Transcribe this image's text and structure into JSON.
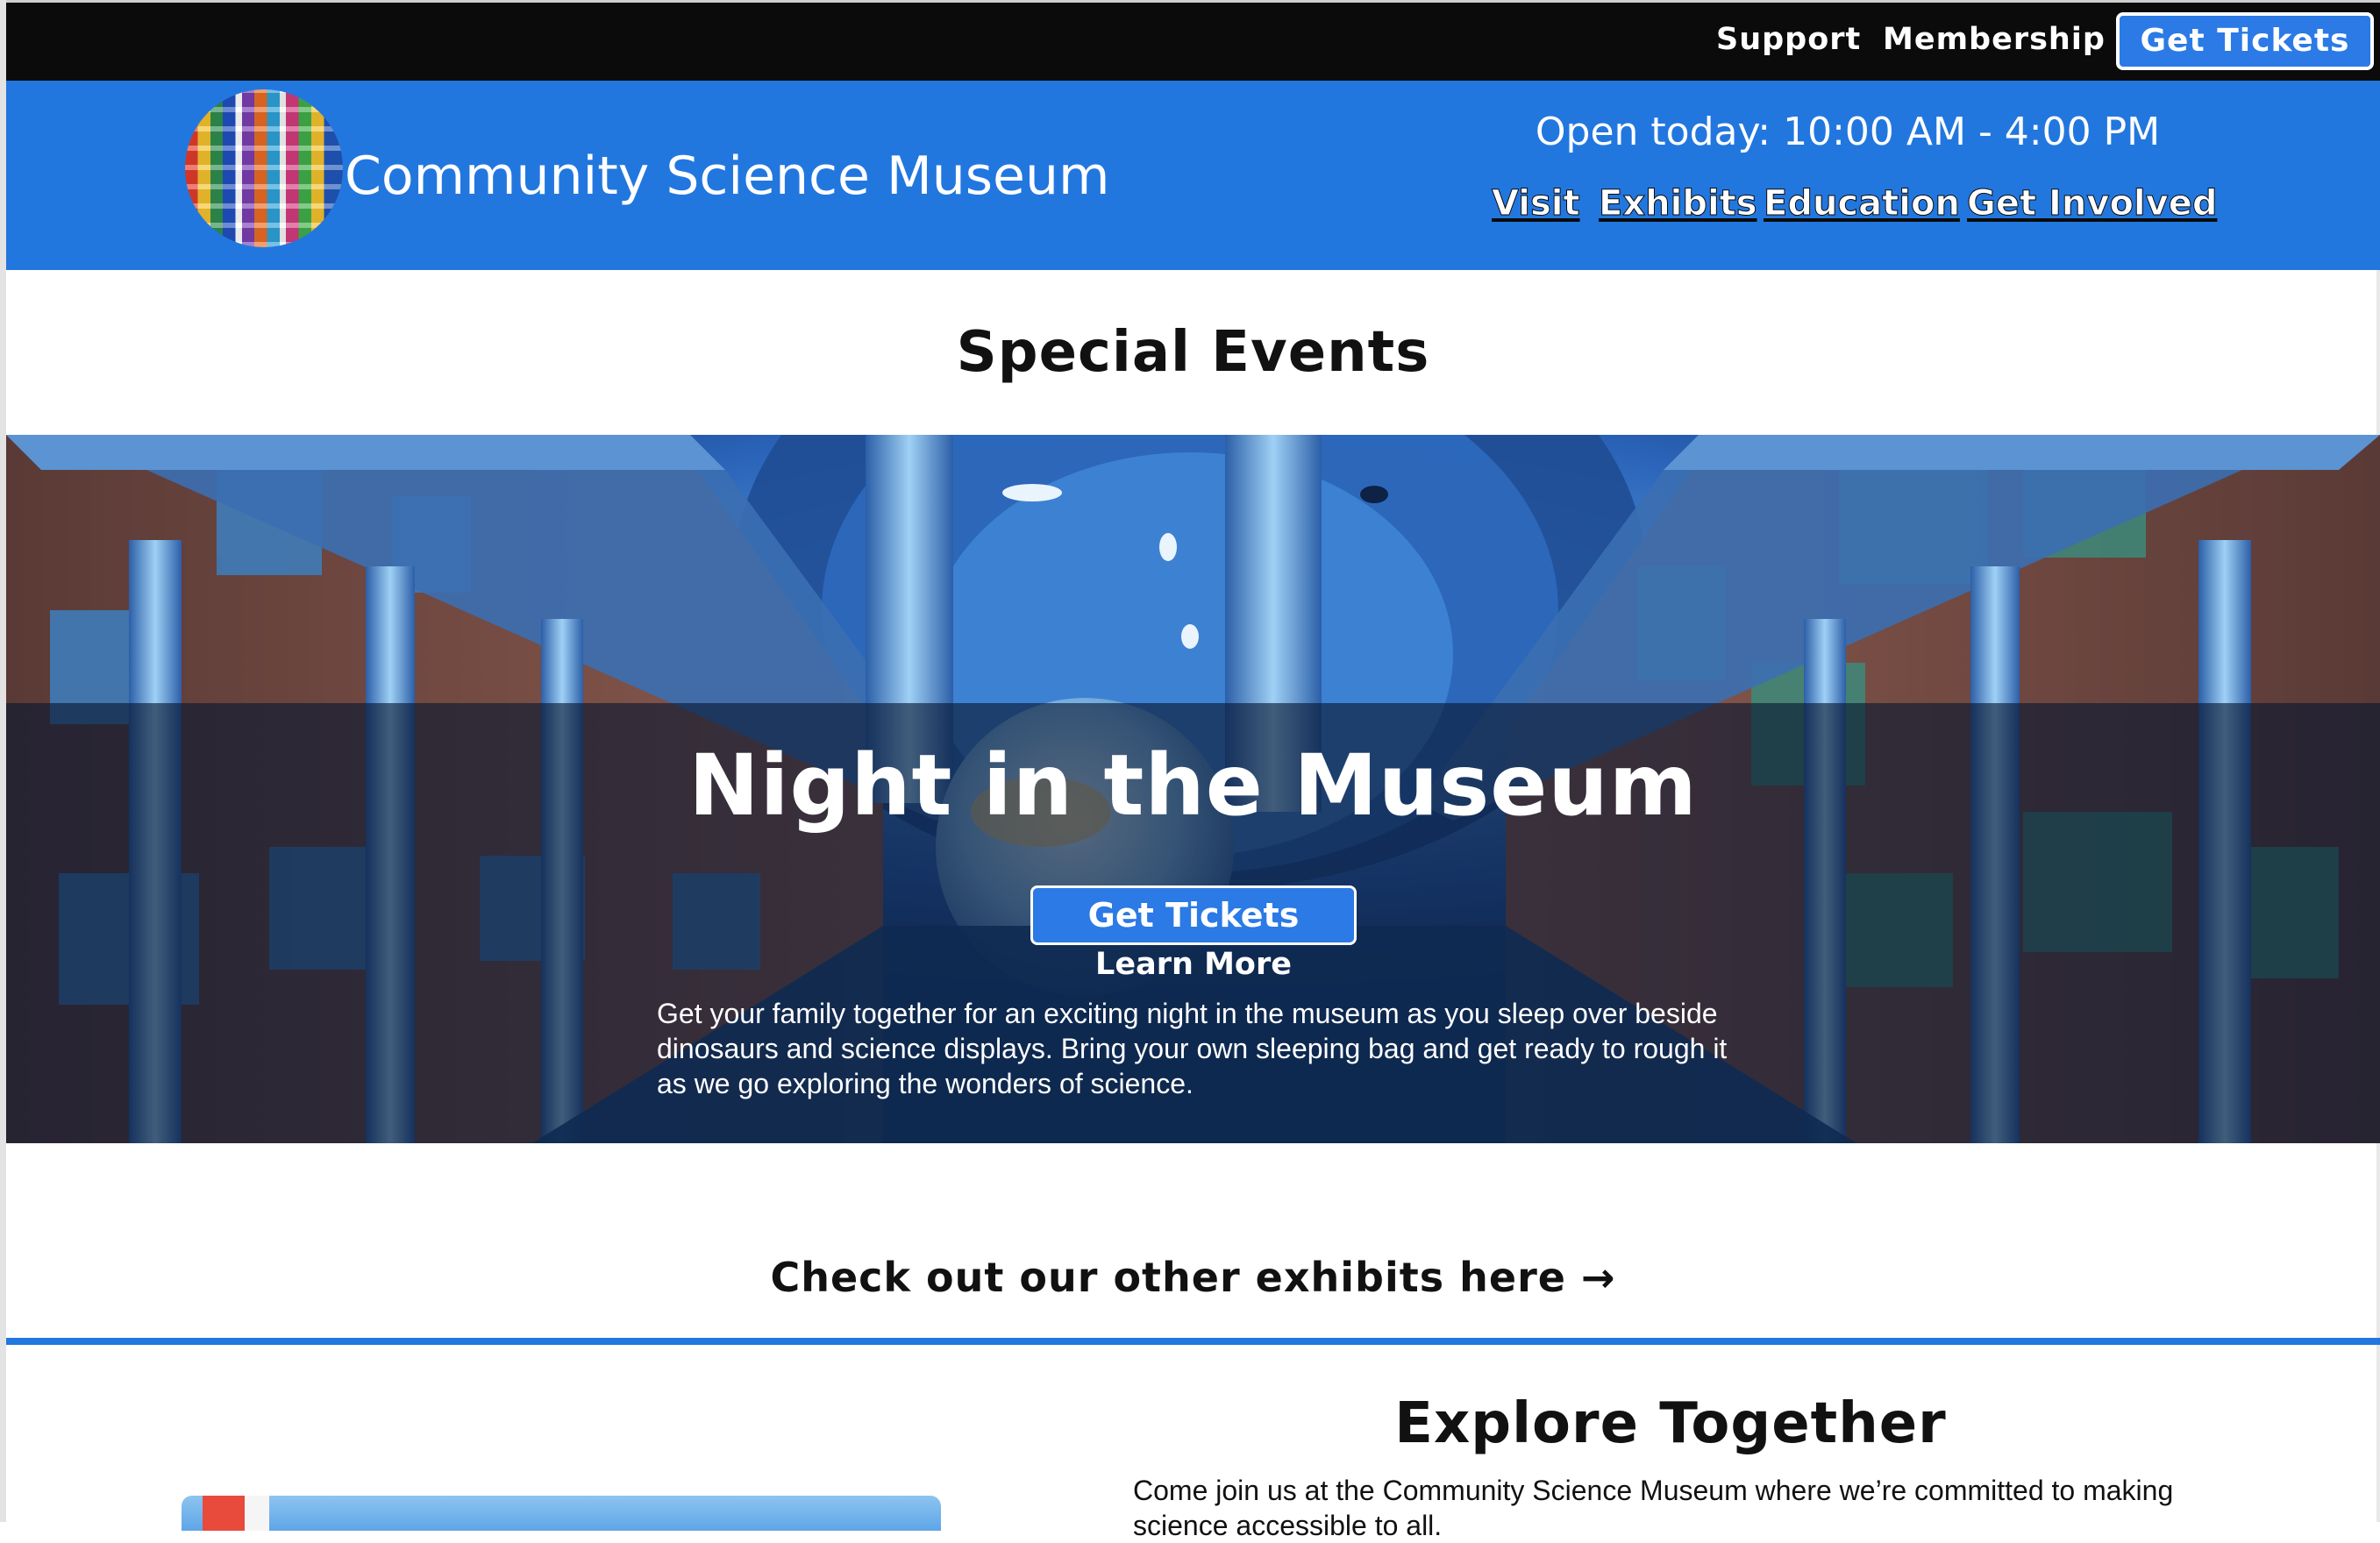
{
  "utility_nav": {
    "support": "Support",
    "membership": "Membership",
    "get_tickets": "Get Tickets"
  },
  "header": {
    "site_title": "Community Science Museum",
    "hours": "Open today: 10:00 AM - 4:00 PM",
    "nav": [
      "Visit",
      "Exhibits",
      "Education",
      "Get Involved"
    ]
  },
  "special_events": {
    "title": "Special Events",
    "event_title": "Night in the Museum",
    "get_tickets": "Get Tickets",
    "learn_more": "Learn More",
    "description": "Get your family together for an exciting night in the museum as you sleep over beside dinosaurs and science displays. Bring your own sleeping bag and get ready to rough it as we go exploring the wonders of science."
  },
  "exhibits_link": "Check out our other exhibits here →",
  "explore": {
    "title": "Explore Together",
    "text": "Come join us at the Community Science Museum where we’re committed to making science accessible to all."
  },
  "colors": {
    "brand_blue": "#2277df",
    "button_blue": "#2b7ae6",
    "top_bar": "#0b0b0b"
  }
}
